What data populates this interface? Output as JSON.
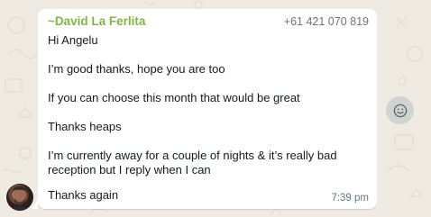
{
  "message": {
    "sender_name": "~David La Ferlita",
    "sender_phone": "+61 421 070 819",
    "lines": [
      "Hi Angelu",
      "",
      "I’m good thanks, hope you are too",
      "",
      "If you can choose this month that would be great",
      "",
      "Thanks heaps",
      "",
      "I’m currently away for a couple of nights & it’s really bad",
      "reception but I reply when I can",
      ""
    ],
    "last_line": "Thanks again",
    "time": "7:39 pm"
  },
  "icons": {
    "reaction": "smiley-icon",
    "avatar": "avatar"
  },
  "colors": {
    "sender_name": "#7fb93a",
    "wallpaper": "#efeae2",
    "bubble": "#ffffff",
    "meta_text": "#667781"
  }
}
